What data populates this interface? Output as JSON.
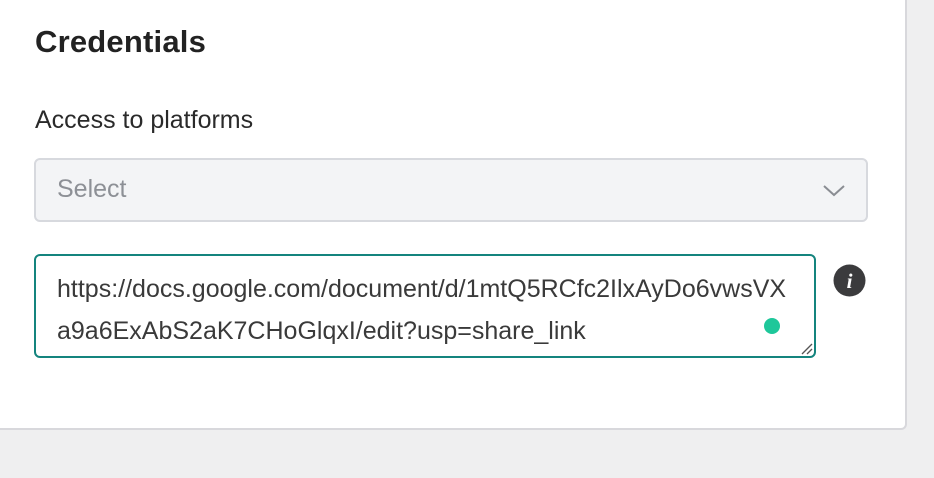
{
  "section": {
    "title": "Credentials"
  },
  "access_field": {
    "label": "Access to platforms",
    "placeholder": "Select",
    "icon": "chevron-down-icon"
  },
  "link_field": {
    "value": "https://docs.google.com/document/d/1mtQ5RCfc2IlxAyDo6vwsVXa9a6ExAbS2aK7CHoGlqxI/edit?usp=share_link",
    "status_color": "#1ec79a",
    "border_color": "#14847e"
  },
  "info_icon": {
    "icon": "info-icon",
    "glyph": "i"
  }
}
